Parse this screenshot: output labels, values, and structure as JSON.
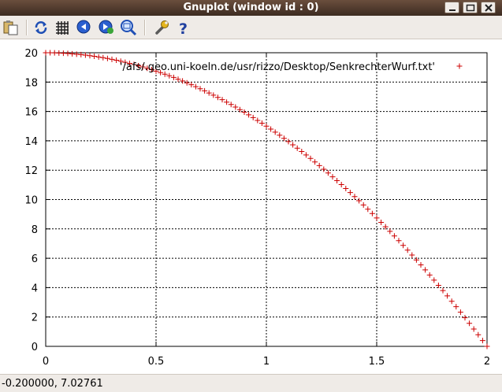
{
  "window": {
    "title": "Gnuplot (window id : 0)"
  },
  "toolbar": {
    "buttons": [
      "copy-clipboard",
      "replot",
      "grid",
      "previous-zoom",
      "next-zoom",
      "autoscale",
      "settings",
      "help"
    ]
  },
  "status": {
    "coords": "-0.200000,  7.02761"
  },
  "colors": {
    "series": "#cc0000",
    "titlebar": "#4e3a2e"
  },
  "chart_data": {
    "type": "scatter",
    "title": "",
    "xlabel": "",
    "ylabel": "",
    "xlim": [
      0,
      2
    ],
    "ylim": [
      0,
      20
    ],
    "grid": true,
    "legend_position": "top-right",
    "x_ticks": [
      "0",
      "0.5",
      "1",
      "1.5",
      "2"
    ],
    "y_ticks": [
      "0",
      "2",
      "4",
      "6",
      "8",
      "10",
      "12",
      "14",
      "16",
      "18",
      "20"
    ],
    "series": [
      {
        "name": "'/afs/.geo.uni-koeln.de/usr/rizzo/Desktop/SenkrechterWurf.txt'",
        "marker": "+",
        "x": [
          0.0,
          0.02,
          0.04,
          0.06,
          0.08,
          0.1,
          0.12,
          0.14,
          0.16,
          0.18,
          0.2,
          0.22,
          0.24,
          0.26,
          0.28,
          0.3,
          0.32,
          0.34,
          0.36,
          0.38,
          0.4,
          0.42,
          0.44,
          0.46,
          0.48,
          0.5,
          0.52,
          0.54,
          0.56,
          0.58,
          0.6,
          0.62,
          0.64,
          0.66,
          0.68,
          0.7,
          0.72,
          0.74,
          0.76,
          0.78,
          0.8,
          0.82,
          0.84,
          0.86,
          0.88,
          0.9,
          0.92,
          0.94,
          0.96,
          0.98,
          1.0,
          1.02,
          1.04,
          1.06,
          1.08,
          1.1,
          1.12,
          1.14,
          1.16,
          1.18,
          1.2,
          1.22,
          1.24,
          1.26,
          1.28,
          1.3,
          1.32,
          1.34,
          1.36,
          1.38,
          1.4,
          1.42,
          1.44,
          1.46,
          1.48,
          1.5,
          1.52,
          1.54,
          1.56,
          1.58,
          1.6,
          1.62,
          1.64,
          1.66,
          1.68,
          1.7,
          1.72,
          1.74,
          1.76,
          1.78,
          1.8,
          1.82,
          1.84,
          1.86,
          1.88,
          1.9,
          1.92,
          1.94,
          1.96,
          1.98,
          2.0
        ],
        "y": [
          20.0,
          19.998,
          19.992,
          19.982,
          19.968,
          19.95,
          19.928,
          19.902,
          19.872,
          19.838,
          19.8,
          19.758,
          19.712,
          19.662,
          19.608,
          19.55,
          19.488,
          19.422,
          19.352,
          19.278,
          19.2,
          19.118,
          19.032,
          18.942,
          18.848,
          18.75,
          18.648,
          18.542,
          18.432,
          18.318,
          18.2,
          18.078,
          17.952,
          17.822,
          17.688,
          17.55,
          17.408,
          17.262,
          17.112,
          16.958,
          16.8,
          16.638,
          16.472,
          16.302,
          16.128,
          15.95,
          15.768,
          15.582,
          15.392,
          15.198,
          15.0,
          14.798,
          14.592,
          14.382,
          14.168,
          13.95,
          13.728,
          13.502,
          13.272,
          13.038,
          12.8,
          12.558,
          12.312,
          12.062,
          11.808,
          11.55,
          11.288,
          11.022,
          10.752,
          10.478,
          10.2,
          9.918,
          9.632,
          9.342,
          9.048,
          8.75,
          8.448,
          8.142,
          7.832,
          7.518,
          7.2,
          6.878,
          6.552,
          6.222,
          5.888,
          5.55,
          5.208,
          4.862,
          4.512,
          4.158,
          3.8,
          3.438,
          3.072,
          2.702,
          2.328,
          1.95,
          1.568,
          1.182,
          0.792,
          0.398,
          0.0
        ]
      }
    ]
  }
}
